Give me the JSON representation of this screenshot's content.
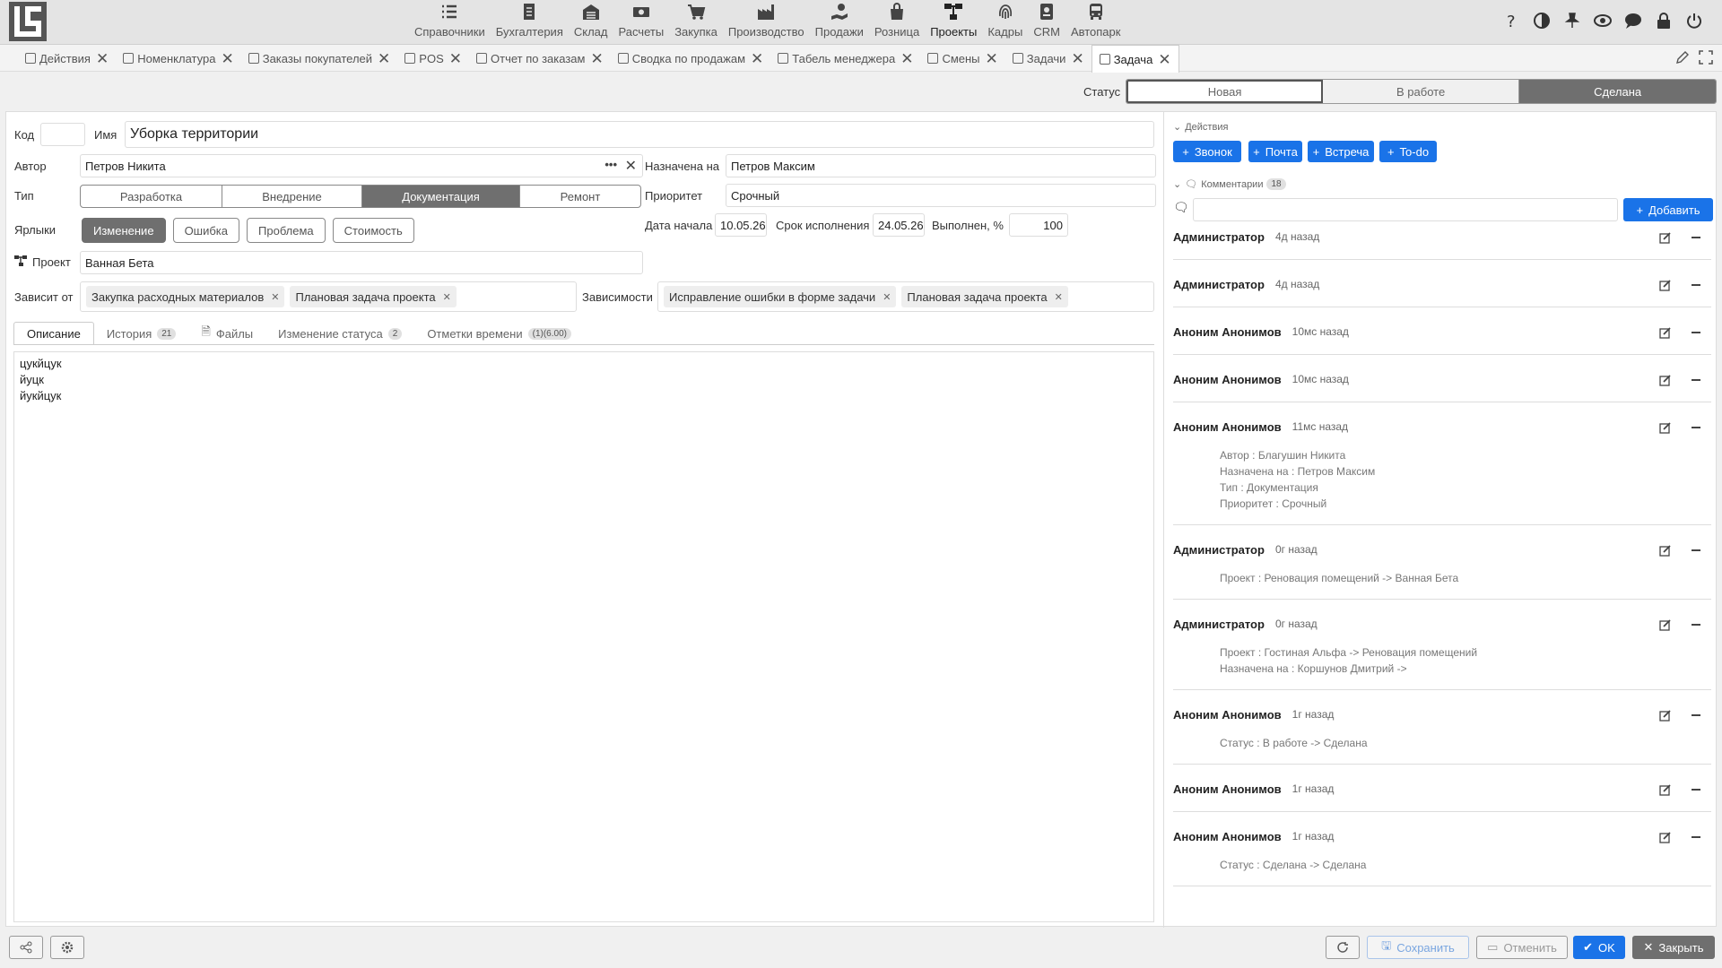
{
  "nav": {
    "items": [
      {
        "label": "Справочники",
        "icon": "list-icon"
      },
      {
        "label": "Бухгалтерия",
        "icon": "ledger-icon"
      },
      {
        "label": "Склад",
        "icon": "warehouse-icon"
      },
      {
        "label": "Расчеты",
        "icon": "money-icon"
      },
      {
        "label": "Закупка",
        "icon": "cart-icon"
      },
      {
        "label": "Производство",
        "icon": "factory-icon"
      },
      {
        "label": "Продажи",
        "icon": "hand-money-icon"
      },
      {
        "label": "Розница",
        "icon": "bag-icon"
      },
      {
        "label": "Проекты",
        "icon": "sitemap-icon"
      },
      {
        "label": "Кадры",
        "icon": "fingerprint-icon"
      },
      {
        "label": "CRM",
        "icon": "badge-icon"
      },
      {
        "label": "Автопарк",
        "icon": "bus-icon"
      }
    ]
  },
  "tabs": [
    {
      "label": "Действия"
    },
    {
      "label": "Номенклатура"
    },
    {
      "label": "Заказы покупателей"
    },
    {
      "label": "POS"
    },
    {
      "label": "Отчет по заказам"
    },
    {
      "label": "Сводка по продажам"
    },
    {
      "label": "Табель менеджера"
    },
    {
      "label": "Смены"
    },
    {
      "label": "Задачи"
    },
    {
      "label": "Задача"
    }
  ],
  "status": {
    "label": "Статус",
    "options": [
      "Новая",
      "В работе",
      "Сделана"
    ],
    "selected": "Сделана"
  },
  "form": {
    "code_label": "Код",
    "code_value": "",
    "name_label": "Имя",
    "name_value": "Уборка территории",
    "author_label": "Автор",
    "author_value": "Петров Никита",
    "assigned_label": "Назначена на",
    "assigned_value": "Петров Максим",
    "type_label": "Тип",
    "type_options": [
      "Разработка",
      "Внедрение",
      "Документация",
      "Ремонт"
    ],
    "type_selected": "Документация",
    "priority_label": "Приоритет",
    "priority_value": "Срочный",
    "tags_label": "Ярлыки",
    "tags": [
      "Изменение",
      "Ошибка",
      "Проблема",
      "Стоимость"
    ],
    "tags_selected": "Изменение",
    "start_label": "Дата начала",
    "start_value": "10.05.26",
    "due_label": "Срок исполнения",
    "due_value": "24.05.26",
    "done_label": "Выполнен, %",
    "done_value": "100",
    "project_label": "Проект",
    "project_value": "Ванная Бета",
    "depends_on_label": "Зависит от",
    "depends_on": [
      "Закупка расходных материалов",
      "Плановая задача проекта"
    ],
    "dependencies_label": "Зависимости",
    "dependencies": [
      "Исправление ошибки в форме задачи",
      "Плановая задача проекта"
    ]
  },
  "subtabs": [
    {
      "label": "Описание",
      "badge": ""
    },
    {
      "label": "История",
      "badge": "21"
    },
    {
      "label": "Файлы",
      "badge": ""
    },
    {
      "label": "Изменение статуса",
      "badge": "2"
    },
    {
      "label": "Отметки времени",
      "badge": "(1)(6.00)"
    }
  ],
  "description": [
    "цукйцук",
    "йуцк",
    "йукйцук"
  ],
  "actions": {
    "label": "Действия",
    "buttons": [
      "Звонок",
      "Почта",
      "Встреча",
      "To-do"
    ]
  },
  "comments_section": {
    "label": "Комментарии",
    "count": "18",
    "input_placeholder": "",
    "add_label": "Добавить"
  },
  "comments": [
    {
      "author": "Администратор",
      "time": "4д назад",
      "lines": []
    },
    {
      "author": "Администратор",
      "time": "4д назад",
      "lines": []
    },
    {
      "author": "Аноним Анонимов",
      "time": "10мс назад",
      "lines": []
    },
    {
      "author": "Аноним Анонимов",
      "time": "10мс назад",
      "lines": []
    },
    {
      "author": "Аноним Анонимов",
      "time": "11мс назад",
      "lines": [
        "Автор : Благушин Никита",
        "Назначена на : Петров Максим",
        "Тип : Документация",
        "Приоритет : Срочный"
      ]
    },
    {
      "author": "Администратор",
      "time": "0г назад",
      "lines": [
        "Проект : Реновация помещений -> Ванная Бета"
      ]
    },
    {
      "author": "Администратор",
      "time": "0г назад",
      "lines": [
        "Проект : Гостиная Альфа -> Реновация помещений",
        "Назначена на : Коршунов Дмитрий ->"
      ]
    },
    {
      "author": "Аноним Анонимов",
      "time": "1г назад",
      "lines": [
        "Статус : В работе -> Сделана"
      ]
    },
    {
      "author": "Аноним Анонимов",
      "time": "1г назад",
      "lines": []
    },
    {
      "author": "Аноним Анонимов",
      "time": "1г назад",
      "lines": [
        "Статус : Сделана -> Сделана"
      ]
    }
  ],
  "bottom": {
    "save_label": "Сохранить",
    "cancel_label": "Отменить",
    "ok_label": "OK",
    "close_label": "Закрыть"
  },
  "colors": {
    "accent": "#1a73e8",
    "selected": "#6f6f6f"
  }
}
